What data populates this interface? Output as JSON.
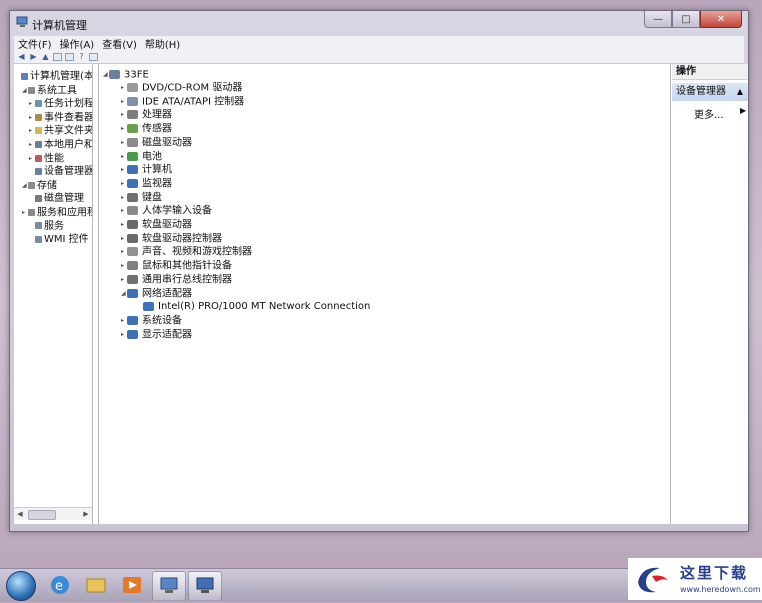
{
  "window": {
    "title": "计算机管理",
    "min_glyph": "—",
    "max_glyph": "□",
    "close_glyph": "✕"
  },
  "menu": [
    "文件(F)",
    "操作(A)",
    "查看(V)",
    "帮助(H)"
  ],
  "left_tree": [
    {
      "label": "计算机管理(本地",
      "icon": "computer-management-icon",
      "color": "#5a7fb8",
      "indent": 0,
      "expander": ""
    },
    {
      "label": "系统工具",
      "icon": "tools-icon",
      "color": "#8a8a8a",
      "indent": 1,
      "expander": "◢"
    },
    {
      "label": "任务计划程",
      "icon": "clock-icon",
      "color": "#6f8fb0",
      "indent": 2,
      "expander": "▸"
    },
    {
      "label": "事件查看器",
      "icon": "event-viewer-icon",
      "color": "#b08a55",
      "indent": 2,
      "expander": "▸"
    },
    {
      "label": "共享文件夹",
      "icon": "shared-folder-icon",
      "color": "#d8b650",
      "indent": 2,
      "expander": "▸"
    },
    {
      "label": "本地用户和",
      "icon": "users-icon",
      "color": "#6a7f99",
      "indent": 2,
      "expander": "▸"
    },
    {
      "label": "性能",
      "icon": "performance-icon",
      "color": "#c05a5a",
      "indent": 2,
      "expander": "▸"
    },
    {
      "label": "设备管理器",
      "icon": "device-manager-icon",
      "color": "#6c7fa0",
      "indent": 2,
      "expander": ""
    },
    {
      "label": "存储",
      "icon": "storage-icon",
      "color": "#8a8a8a",
      "indent": 1,
      "expander": "◢"
    },
    {
      "label": "磁盘管理",
      "icon": "disk-icon",
      "color": "#7a7a7a",
      "indent": 2,
      "expander": ""
    },
    {
      "label": "服务和应用程",
      "icon": "services-icon",
      "color": "#8a8a8a",
      "indent": 1,
      "expander": "▸"
    },
    {
      "label": "服务",
      "icon": "gear-icon",
      "color": "#7a8aa0",
      "indent": 2,
      "expander": ""
    },
    {
      "label": "WMI 控件",
      "icon": "wmi-icon",
      "color": "#7a8aa0",
      "indent": 2,
      "expander": ""
    }
  ],
  "device_tree": {
    "root": "33FE",
    "categories": [
      {
        "label": "DVD/CD-ROM 驱动器",
        "icon": "dvd-drive-icon",
        "color": "#9a9a9a"
      },
      {
        "label": "IDE ATA/ATAPI 控制器",
        "icon": "ide-controller-icon",
        "color": "#8090a8"
      },
      {
        "label": "处理器",
        "icon": "processor-icon",
        "color": "#7d7d7d"
      },
      {
        "label": "传感器",
        "icon": "sensor-icon",
        "color": "#6aa04a"
      },
      {
        "label": "磁盘驱动器",
        "icon": "disk-drive-icon",
        "color": "#8a8a8a"
      },
      {
        "label": "电池",
        "icon": "battery-icon",
        "color": "#4a9a4a"
      },
      {
        "label": "计算机",
        "icon": "computer-icon",
        "color": "#3f6fb5"
      },
      {
        "label": "监视器",
        "icon": "monitor-icon",
        "color": "#3f6fb5"
      },
      {
        "label": "键盘",
        "icon": "keyboard-icon",
        "color": "#707070"
      },
      {
        "label": "人体学输入设备",
        "icon": "hid-icon",
        "color": "#8a8a8a"
      },
      {
        "label": "软盘驱动器",
        "icon": "floppy-drive-icon",
        "color": "#6a6a6a"
      },
      {
        "label": "软盘驱动器控制器",
        "icon": "floppy-controller-icon",
        "color": "#6a6a6a"
      },
      {
        "label": "声音、视频和游戏控制器",
        "icon": "sound-icon",
        "color": "#909090"
      },
      {
        "label": "鼠标和其他指针设备",
        "icon": "mouse-icon",
        "color": "#808080"
      },
      {
        "label": "通用串行总线控制器",
        "icon": "usb-icon",
        "color": "#707070"
      },
      {
        "label": "网络适配器",
        "icon": "network-adapter-icon",
        "color": "#3f6fb5",
        "expanded": true
      },
      {
        "label": "Intel(R) PRO/1000 MT Network Connection",
        "icon": "network-card-icon",
        "color": "#3f6fb5",
        "child": true
      },
      {
        "label": "系统设备",
        "icon": "system-device-icon",
        "color": "#3f6fb5"
      },
      {
        "label": "显示适配器",
        "icon": "display-adapter-icon",
        "color": "#3f6fb5"
      }
    ]
  },
  "actions": {
    "header": "操作",
    "section": "设备管理器",
    "more": "更多..."
  },
  "watermark": {
    "text": "这里下载",
    "url": "www.heredown.com"
  }
}
